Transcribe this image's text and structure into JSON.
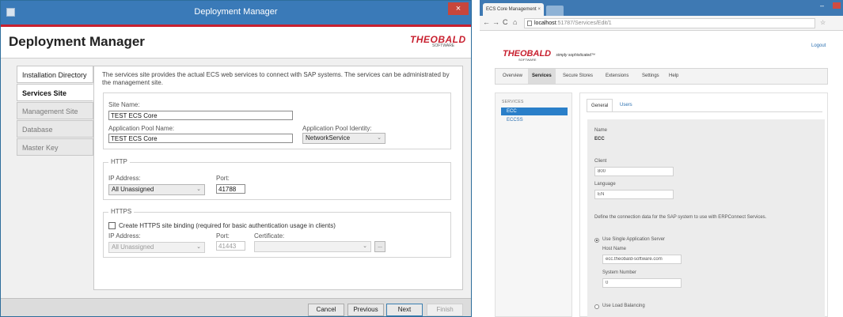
{
  "deployment_manager": {
    "window_title": "Deployment Manager",
    "close_glyph": "×",
    "header_title": "Deployment Manager",
    "logo": {
      "brand": "THEOBALD",
      "sub": "SOFTWARE"
    },
    "nav": [
      {
        "label": "Installation Directory",
        "state": "enabled"
      },
      {
        "label": "Services Site",
        "state": "active"
      },
      {
        "label": "Management Site",
        "state": "disabled"
      },
      {
        "label": "Database",
        "state": "disabled"
      },
      {
        "label": "Master Key",
        "state": "disabled"
      }
    ],
    "description": "The services site provides the actual ECS web services to connect with SAP systems. The services can be administrated by the management site.",
    "site": {
      "site_name_label": "Site Name:",
      "site_name_value": "TEST ECS Core",
      "app_pool_name_label": "Application Pool Name:",
      "app_pool_name_value": "TEST ECS Core",
      "app_pool_identity_label": "Application Pool Identity:",
      "app_pool_identity_value": "NetworkService"
    },
    "http": {
      "group_title": "HTTP",
      "ip_label": "IP Address:",
      "ip_value": "All Unassigned",
      "port_label": "Port:",
      "port_value": "41788"
    },
    "https": {
      "group_title": "HTTPS",
      "checkbox_label": "Create HTTPS site binding (required for basic authentication usage in clients)",
      "checkbox_checked": false,
      "ip_label": "IP Address:",
      "ip_value": "All Unassigned",
      "port_label": "Port:",
      "port_value": "41443",
      "certificate_label": "Certificate:",
      "certificate_value": "",
      "browse_label": "..."
    },
    "buttons": {
      "cancel": "Cancel",
      "previous": "Previous",
      "next": "Next",
      "finish": "Finish"
    }
  },
  "browser": {
    "tab_title": "ECS Core Management",
    "tab_close": "×",
    "url_host": "localhost",
    "url_path": ":51787/Services/Edit/1",
    "logo": {
      "brand": "THEOBALD",
      "tagline": "simply sophisticated™",
      "sub": "SOFTWARE"
    },
    "logout": "Logout",
    "menu": [
      {
        "label": "Overview",
        "active": false
      },
      {
        "label": "Services",
        "active": true
      },
      {
        "label": "Secure Stores",
        "active": false
      },
      {
        "label": "Extensions",
        "active": false
      },
      {
        "label": "Settings",
        "active": false
      },
      {
        "label": "Help",
        "active": false
      }
    ],
    "sidebar": {
      "heading": "SERVICES",
      "items": [
        {
          "label": "ECC",
          "active": true
        },
        {
          "label": "ECCSS",
          "active": false
        }
      ]
    },
    "tabs": [
      {
        "label": "General",
        "active": true
      },
      {
        "label": "Users",
        "active": false
      }
    ],
    "form": {
      "name_label": "Name",
      "name_value": "ECC",
      "client_label": "Client",
      "client_value": "800",
      "language_label": "Language",
      "language_value": "EN",
      "connection_note": "Define the connection data for the SAP system to use with ERPConnect Services.",
      "single_server_label": "Use Single Application Server",
      "host_label": "Host Name",
      "host_value": "ecc.theobald-software.com",
      "sysnum_label": "System Number",
      "sysnum_value": "0",
      "load_balancing_label": "Use Load Balancing"
    }
  }
}
